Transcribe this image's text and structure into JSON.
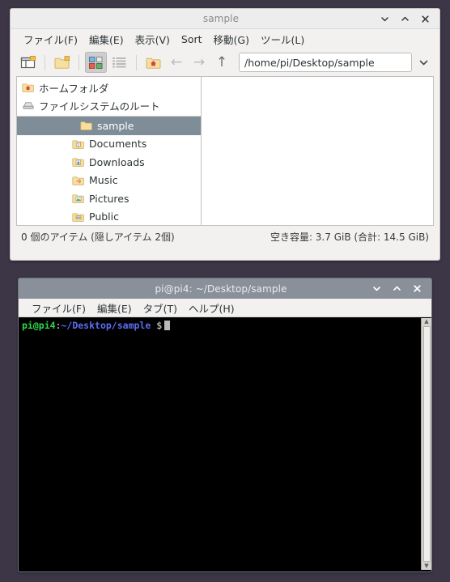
{
  "desktop": {
    "background": "#3c3647"
  },
  "filemanager": {
    "title": "sample",
    "controls": {
      "minimize": "minimize-icon",
      "maximize": "maximize-icon",
      "close": "close-icon"
    },
    "menus": [
      {
        "label": "ファイル(F)",
        "name": "menu-file"
      },
      {
        "label": "編集(E)",
        "name": "menu-edit"
      },
      {
        "label": "表示(V)",
        "name": "menu-view"
      },
      {
        "label": "Sort",
        "name": "menu-sort"
      },
      {
        "label": "移動(G)",
        "name": "menu-go"
      },
      {
        "label": "ツール(L)",
        "name": "menu-tools"
      }
    ],
    "toolbar": {
      "new_tab": "new-tab-icon",
      "new_folder": "new-folder-icon",
      "icon_view": "icon-view-icon",
      "list_view": "list-view-icon",
      "home": "home-folder-icon",
      "back": "←",
      "forward": "→",
      "up": "↑",
      "path_value": "/home/pi/Desktop/sample",
      "path_dropdown": "chevron-down-icon"
    },
    "sidebar": {
      "bookmarks": [
        {
          "label": "ホームフォルダ",
          "icon": "home-folder-icon"
        },
        {
          "label": "ファイルシステムのルート",
          "icon": "drive-icon"
        }
      ],
      "tree": [
        {
          "label": "sample",
          "icon": "folder-icon",
          "selected": true
        },
        {
          "label": "Documents",
          "icon": "documents-folder-icon",
          "selected": false
        },
        {
          "label": "Downloads",
          "icon": "downloads-folder-icon",
          "selected": false
        },
        {
          "label": "Music",
          "icon": "music-folder-icon",
          "selected": false
        },
        {
          "label": "Pictures",
          "icon": "pictures-folder-icon",
          "selected": false
        },
        {
          "label": "Public",
          "icon": "public-folder-icon",
          "selected": false
        }
      ]
    },
    "statusbar": {
      "items": "0 個のアイテム (隠しアイテム 2個)",
      "space": "空き容量: 3.7 GiB (合計: 14.5 GiB)"
    }
  },
  "terminal": {
    "title": "pi@pi4: ~/Desktop/sample",
    "controls": {
      "minimize": "minimize-icon",
      "maximize": "maximize-icon",
      "close": "close-icon"
    },
    "menus": [
      {
        "label": "ファイル(F)",
        "name": "menu-file"
      },
      {
        "label": "編集(E)",
        "name": "menu-edit"
      },
      {
        "label": "タブ(T)",
        "name": "menu-tab"
      },
      {
        "label": "ヘルプ(H)",
        "name": "menu-help"
      }
    ],
    "prompt": {
      "user": "pi@pi4",
      "colon": ":",
      "path": "~/Desktop/sample",
      "symbol": "$"
    },
    "colors": {
      "background": "#000000",
      "user": "#2fd64c",
      "path": "#5c6cf2",
      "text": "#e6e6e6"
    }
  }
}
